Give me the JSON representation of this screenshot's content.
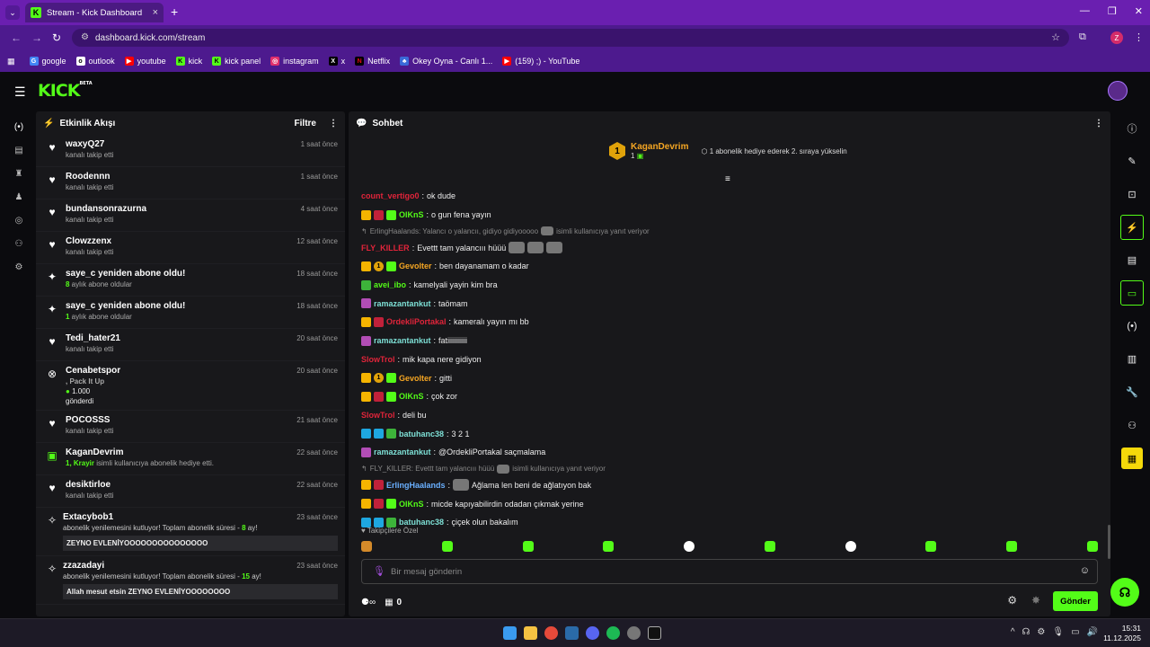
{
  "browser": {
    "tab_title": "Stream - Kick Dashboard",
    "tab_favicon": "K",
    "url": "dashboard.kick.com/stream",
    "profile_initial": "Z",
    "bookmarks": [
      {
        "label": "google",
        "icon": "google-icon",
        "color": "#4285f4"
      },
      {
        "label": "outlook",
        "icon": "outlook-icon",
        "color": "#ffffff"
      },
      {
        "label": "youtube",
        "icon": "youtube-icon",
        "color": "#ff0000"
      },
      {
        "label": "kick",
        "icon": "kick-icon",
        "color": "#53fc18"
      },
      {
        "label": "kick panel",
        "icon": "kick-icon",
        "color": "#53fc18"
      },
      {
        "label": "instagram",
        "icon": "instagram-icon",
        "color": "#e1306c"
      },
      {
        "label": "x",
        "icon": "x-icon",
        "color": "#000000"
      },
      {
        "label": "Netflix",
        "icon": "netflix-icon",
        "color": "#e50914"
      },
      {
        "label": "Okey Oyna - Canlı 1...",
        "icon": "okey-icon",
        "color": "#3a6ad8"
      },
      {
        "label": "(159) ;) - YouTube",
        "icon": "youtube-icon",
        "color": "#ff0000"
      }
    ]
  },
  "app": {
    "logo": "KICK",
    "logo_badge": "BETA",
    "accent": "#53fc18"
  },
  "activity": {
    "title": "Etkinlik Akışı",
    "filter_label": "Filtre",
    "events": [
      {
        "name": "waxyQ27",
        "sub": "kanalı takip etti",
        "time": "1 saat önce",
        "icon": "heart-icon"
      },
      {
        "name": "Roodennn",
        "sub": "kanalı takip etti",
        "time": "1 saat önce",
        "icon": "heart-icon"
      },
      {
        "name": "bundansonrazurna",
        "sub": "kanalı takip etti",
        "time": "4 saat önce",
        "icon": "heart-icon"
      },
      {
        "name": "Clowzzenx",
        "sub": "kanalı takip etti",
        "time": "12 saat önce",
        "icon": "heart-icon"
      },
      {
        "name": "saye_c yeniden abone oldu!",
        "num": "8",
        "sub": " aylık abone oldular",
        "time": "18 saat önce",
        "icon": "sparkle-icon"
      },
      {
        "name": "saye_c yeniden abone oldu!",
        "num": "1",
        "sub": " aylık abone oldular",
        "time": "18 saat önce",
        "icon": "sparkle-icon"
      },
      {
        "name": "Tedi_hater21",
        "sub": "kanalı takip etti",
        "time": "20 saat önce",
        "icon": "heart-icon"
      },
      {
        "name": "Cenabetspor",
        "line1": ", Pack It Up",
        "line2": "1.000",
        "sub": "gönderdi",
        "time": "20 saat önce",
        "icon": "kicks-icon"
      },
      {
        "name": "POCOSSS",
        "sub": "kanalı takip etti",
        "time": "21 saat önce",
        "icon": "heart-icon"
      },
      {
        "name": "KaganDevrim",
        "num": "1, Krayir",
        "sub": " isimli kullanıcıya abonelik hediye etti.",
        "time": "22 saat önce",
        "icon": "gift-icon"
      },
      {
        "name": "desiktirloe",
        "sub": "kanalı takip etti",
        "time": "22 saat önce",
        "icon": "heart-icon"
      },
      {
        "name": "Extacybob1",
        "sub": "abonelik yenilemesini kutluyor! Toplam abonelik süresi - ",
        "num": "8",
        "sub2": " ay!",
        "msg": "ZEYNO EVLENİYOOOOOOOOOOOOOOO",
        "time": "23 saat önce",
        "icon": "party-icon"
      },
      {
        "name": "zzazadayi",
        "sub": "abonelik yenilemesini kutluyor! Toplam abonelik süresi - ",
        "num": "15",
        "sub2": " ay!",
        "msg": "Allah mesut etsin ZEYNO EVLENİYOOOOOOOO",
        "time": "23 saat önce",
        "icon": "party-icon"
      }
    ]
  },
  "chat": {
    "title": "Sohbet",
    "pinned": {
      "rank": "1",
      "name": "KaganDevrim",
      "count": "1",
      "message": "1 abonelik hediye ederek 2. sıraya yükselin"
    },
    "messages": [
      {
        "user": "count_vertigo0",
        "color": "#e0243a",
        "text": "ok dude",
        "badges": []
      },
      {
        "user": "OlKnS",
        "color": "#53fc18",
        "text": "o gun fena yayın",
        "badges": [
          "crown",
          "red",
          "gift"
        ]
      },
      {
        "reply": "ErlingHaalands: Yalancı o yalancıı, gidiyo gidiyooooo",
        "reply_tail": "isimli kullanıcıya yanıt veriyor"
      },
      {
        "user": "FLY_KILLER",
        "color": "#e0243a",
        "text": "Evettt tam yalancııı hüüü",
        "badges": [],
        "emotes": 3
      },
      {
        "user": "Gevolter",
        "color": "#f5a623",
        "text": "ben dayanamam o kadar",
        "badges": [
          "crown",
          "one",
          "gift"
        ]
      },
      {
        "user": "avei_ibo",
        "color": "#53fc18",
        "text": "kamelyali yayin kim bra",
        "badges": [
          "frog"
        ]
      },
      {
        "user": "ramazantankut",
        "color": "#7ee0d6",
        "text": "taömam",
        "badges": [
          "pink"
        ]
      },
      {
        "user": "OrdekliPortakal",
        "color": "#e0243a",
        "text": "kameralı yayın mı bb",
        "badges": [
          "crown",
          "red"
        ]
      },
      {
        "user": "ramazantankut",
        "color": "#7ee0d6",
        "text": "fatiiiiiiiiiii",
        "badges": [
          "pink"
        ]
      },
      {
        "user": "SlowTrol",
        "color": "#e0243a",
        "text": "mik kapa nere gidiyon",
        "badges": []
      },
      {
        "user": "Gevolter",
        "color": "#f5a623",
        "text": "gitti",
        "badges": [
          "crown",
          "one",
          "gift"
        ]
      },
      {
        "user": "OlKnS",
        "color": "#53fc18",
        "text": "çok zor",
        "badges": [
          "crown",
          "red",
          "gift"
        ]
      },
      {
        "user": "SlowTrol",
        "color": "#e0243a",
        "text": "deli bu",
        "badges": []
      },
      {
        "user": "batuhanc38",
        "color": "#7ee0d6",
        "text": "3 2 1",
        "badges": [
          "blue",
          "blue",
          "frog"
        ]
      },
      {
        "user": "ramazantankut",
        "color": "#7ee0d6",
        "text": "@OrdekliPortakal saçmalama",
        "badges": [
          "pink"
        ]
      },
      {
        "reply": "FLY_KILLER: Evettt tam yalancııı hüüü",
        "reply_tail": "isimli kullanıcıya yanıt veriyor"
      },
      {
        "user": "ErlingHaalands",
        "color": "#6ab0ff",
        "text": "Ağlama len beni de ağlatıyon bak",
        "badges": [
          "crown",
          "red"
        ],
        "emotes": 1
      },
      {
        "user": "OlKnS",
        "color": "#53fc18",
        "text": "micde kapıyabilirdin odadan çıkmak yerine",
        "badges": [
          "crown",
          "red",
          "gift"
        ]
      },
      {
        "user": "batuhanc38",
        "color": "#7ee0d6",
        "text": "çiçek olun bakalım",
        "badges": [
          "blue",
          "blue",
          "frog"
        ]
      }
    ],
    "followers_only": "Takipçilere Özel",
    "input_placeholder": "Bir mesaj gönderin",
    "kicks_count": "0",
    "send_label": "Gönder"
  },
  "taskbar": {
    "time": "15:31",
    "date": "11.12.2025"
  }
}
